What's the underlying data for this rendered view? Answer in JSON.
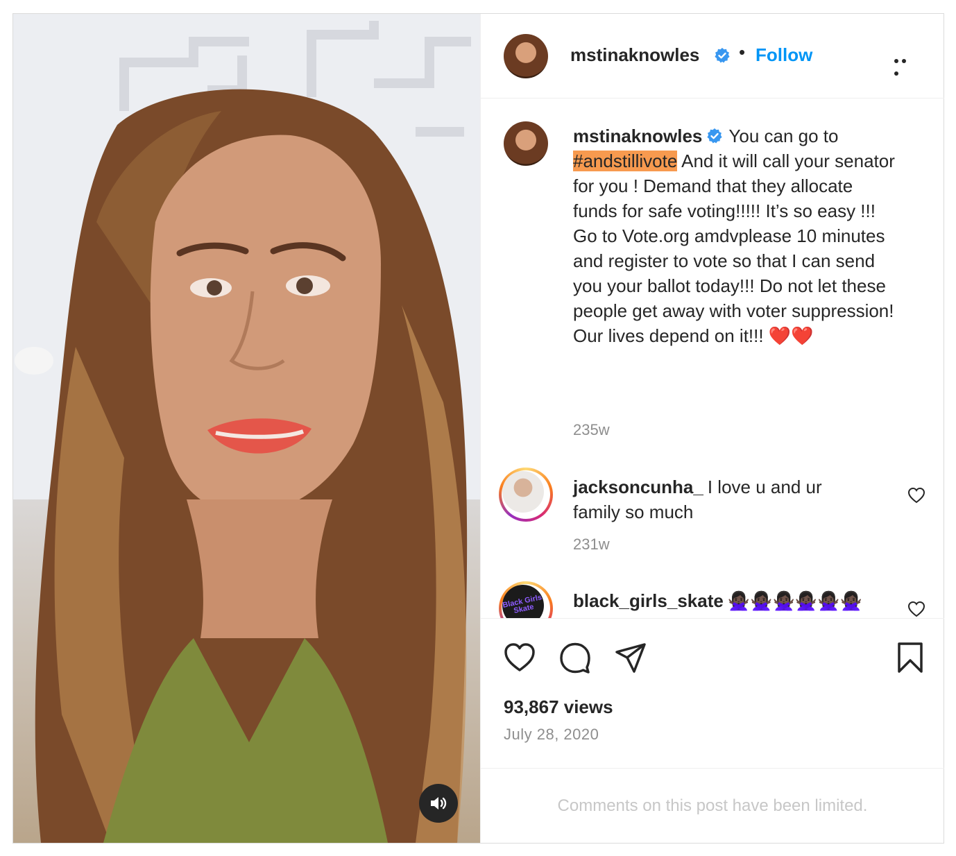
{
  "post": {
    "author": {
      "username": "mstinaknowles",
      "verified": true,
      "avatar_icon": "profile-photo"
    },
    "header": {
      "separator": "•",
      "follow_label": "Follow",
      "more_icon": "ellipsis-icon"
    },
    "caption": {
      "username": "mstinaknowles",
      "text_before": "You can go to ",
      "hashtag": "#andstillivote",
      "text_after": " And it will call your senator for you ! Demand that they allocate funds for safe voting!!!!! It’s so easy !!!",
      "text_line2": "Go to Vote.org amdvplease 10 minutes and register to vote so that I can send you your ballot today!!! Do not let these people get away with voter suppression! Our lives depend on it!!! ❤️❤️",
      "time": "235w"
    },
    "comments": [
      {
        "username": "jacksoncunha_",
        "text": "I love u and ur family so much",
        "time": "231w"
      },
      {
        "username": "black_girls_skate",
        "text": "🙅🏿‍♀️🙅🏿‍♀️🙅🏿‍♀️🙅🏿‍♀️🙅🏿‍♀️🙅🏿‍♀️",
        "avatar_text": "Black Girls Skate",
        "time": ""
      }
    ],
    "views": "93,867 views",
    "date": "July 28, 2020",
    "comments_limited": "Comments on this post have been limited."
  },
  "colors": {
    "follow": "#0095f6",
    "verified": "#3897f0",
    "hashtag_highlight": "#f79a4f",
    "muted_text": "#8e8e8e"
  }
}
